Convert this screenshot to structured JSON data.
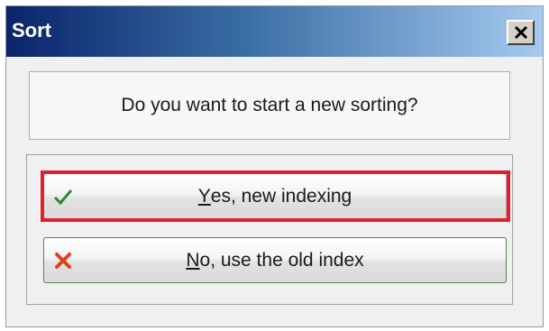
{
  "window": {
    "title": "Sort"
  },
  "question": "Do you want to start a new sorting?",
  "buttons": {
    "yes": {
      "mnemonic": "Y",
      "rest": "es, new indexing",
      "icon": "checkmark-icon"
    },
    "no": {
      "mnemonic": "N",
      "rest": "o, use the old index",
      "icon": "cross-icon"
    }
  },
  "colors": {
    "title_gradient_start": "#0a246a",
    "title_gradient_end": "#a6caf0",
    "highlight": "#e0202a",
    "check": "#2e8b2e",
    "cross": "#e04020"
  }
}
